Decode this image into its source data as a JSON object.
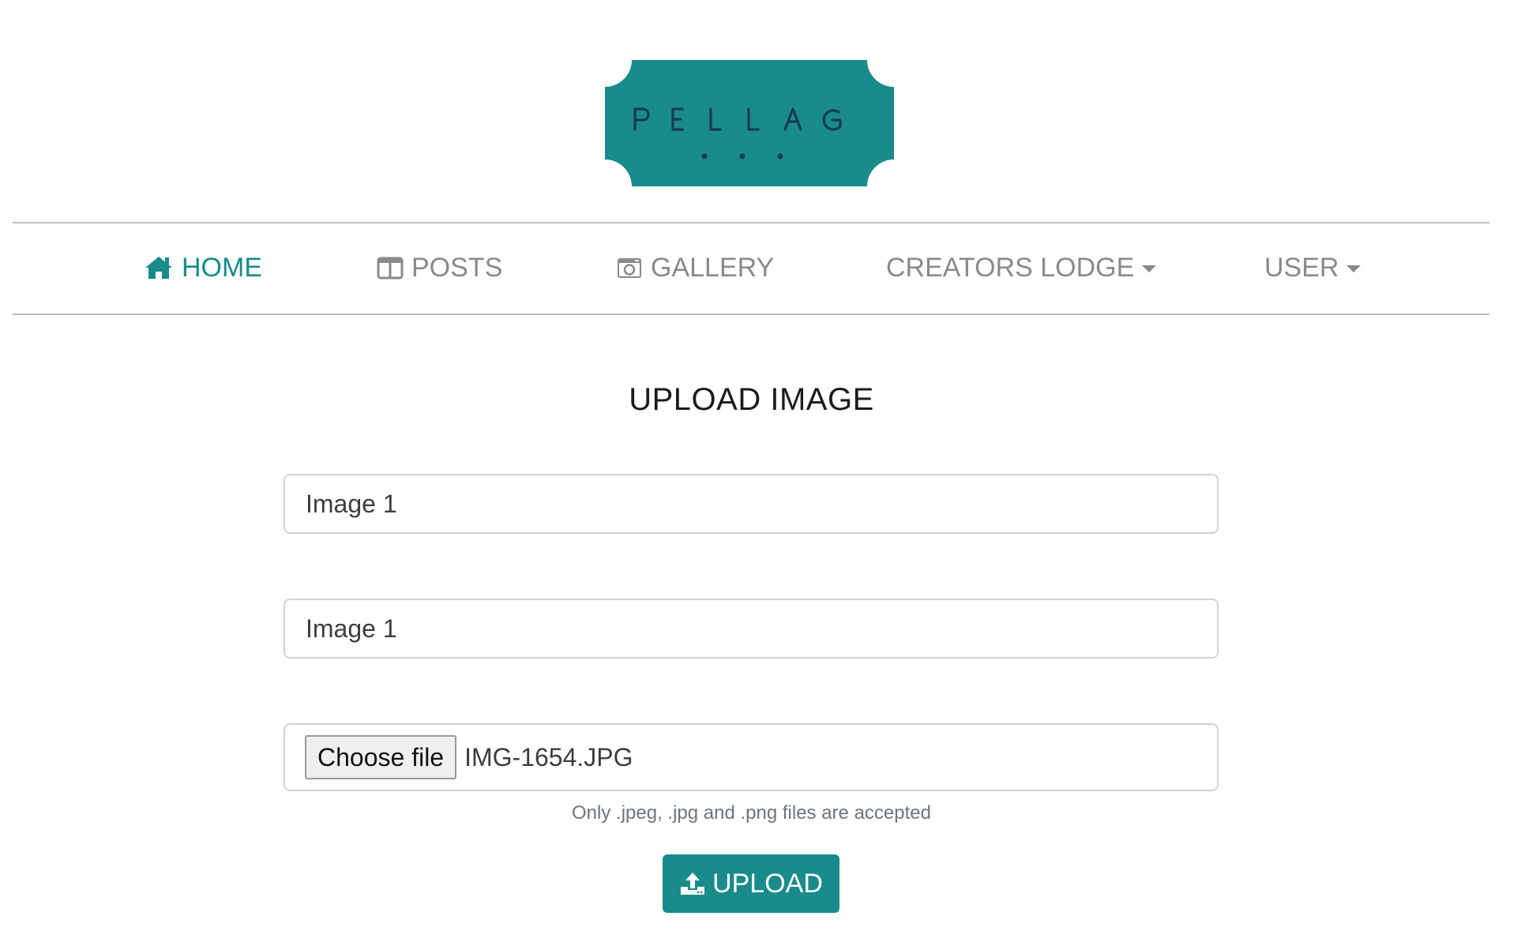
{
  "brand": {
    "logo_text": "PELLAG",
    "logo_color": "#1a8b8b",
    "logo_text_color": "#173a5a"
  },
  "nav": {
    "items": [
      {
        "label": "HOME",
        "icon": "home-icon",
        "active": true
      },
      {
        "label": "POSTS",
        "icon": "columns-icon"
      },
      {
        "label": "GALLERY",
        "icon": "camera-icon"
      },
      {
        "label": "CREATORS LODGE",
        "icon": "caret-down-icon"
      },
      {
        "label": "USER",
        "icon": "caret-down-icon"
      }
    ]
  },
  "form": {
    "title": "UPLOAD IMAGE",
    "field1_value": "Image 1",
    "field2_value": "Image 1",
    "file_button_label": "Choose file",
    "file_name": "IMG-1654.JPG",
    "help_text": "Only .jpeg, .jpg and .png files are accepted",
    "submit_label": "UPLOAD",
    "submit_icon": "upload-icon"
  },
  "colors": {
    "accent": "#1a8b8b",
    "nav_text": "#8a8a8a",
    "divider": "#bdbdbd"
  }
}
